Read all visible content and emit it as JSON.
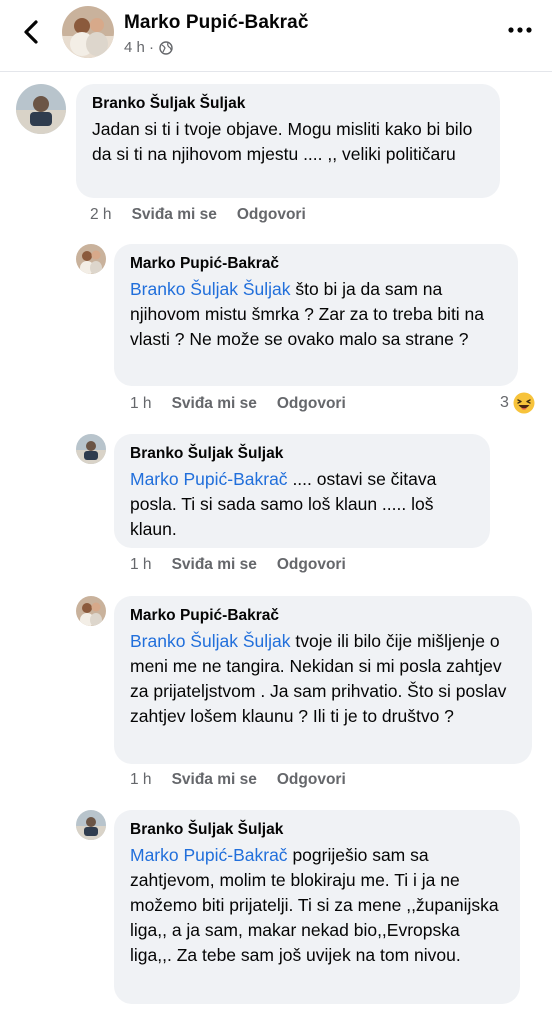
{
  "header": {
    "name": "Marko Pupić-Bakrač",
    "time": "4 h ·"
  },
  "comments": [
    {
      "author": "Branko Šuljak Šuljak",
      "mention": "",
      "text": "Jadan si ti i tvoje objave. Mogu misliti kako bi bilo da si ti na njihovom mjestu .... ,, veliki političaru",
      "time": "2 h",
      "like_label": "Sviđa mi se",
      "reply_label": "Odgovori"
    },
    {
      "author": "Marko Pupić-Bakrač",
      "mention": "Branko Šuljak Šuljak",
      "text": "što bi ja da sam na njihovom mistu šmrka ? Zar za to treba biti na vlasti ? Ne može se ovako malo sa strane ?",
      "time": "1 h",
      "like_label": "Sviđa mi se",
      "reply_label": "Odgovori",
      "reaction_count": "3",
      "reaction": "haha-emoji-icon"
    },
    {
      "author": "Branko Šuljak Šuljak",
      "mention": "Marko Pupić-Bakrač",
      "text": ".... ostavi se čitava posla. Ti si sada samo loš klaun .....  loš klaun.",
      "time": "1 h",
      "like_label": "Sviđa mi se",
      "reply_label": "Odgovori"
    },
    {
      "author": "Marko Pupić-Bakrač",
      "mention": "Branko Šuljak Šuljak",
      "text": "tvoje ili bilo čije mišljenje o meni me ne tangira. Nekidan si mi posla zahtjev za prijateljstvom . Ja sam prihvatio. Što si poslav zahtjev lošem klaunu ? Ili ti je to društvo ?",
      "time": "1 h",
      "like_label": "Sviđa mi se",
      "reply_label": "Odgovori"
    },
    {
      "author": "Branko Šuljak Šuljak",
      "mention": "Marko Pupić-Bakrač",
      "text": "pogriješio sam sa zahtjevom, molim te blokiraju me. Ti i ja ne možemo biti prijatelji. Ti si za mene ,,županijska liga,, a ja sam, makar nekad bio,,Evropska liga,,. Za tebe sam još uvijek na tom nivou."
    }
  ],
  "colors": {
    "accent_link": "#216fdb",
    "bubble_bg": "#f0f2f5",
    "meta_text": "#65676b"
  }
}
